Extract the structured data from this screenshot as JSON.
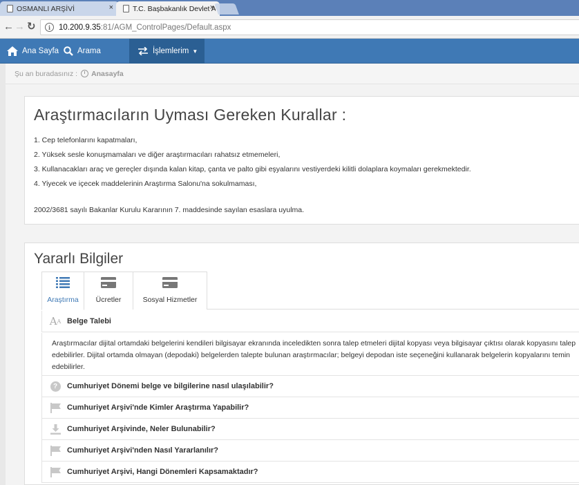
{
  "browser": {
    "tabs": [
      {
        "title": "OSMANLI ARŞİVİ",
        "close": "×"
      },
      {
        "title": "T.C. Başbakanlık Devlet A",
        "close": "×"
      }
    ],
    "url_host": "10.200.9.35",
    "url_path": ":81/AGM_ControlPages/Default.aspx"
  },
  "navbar": {
    "home": "Ana Sayfa",
    "search": "Arama",
    "operations": "İşlemlerim",
    "accent": "#3f79b5"
  },
  "breadcrumb": {
    "prefix": "Şu an buradasınız :",
    "current": "Anasayfa"
  },
  "rules_panel": {
    "title": "Araştırmacıların Uyması Gereken Kurallar :",
    "rules": [
      "1. Cep telefonlarını kapatmaları,",
      "2. Yüksek sesle konuşmamaları ve diğer araştırmacıları rahatsız etmemeleri,",
      "3. Kullanacakları araç ve gereçler dışında kalan kitap, çanta ve palto gibi eşyalarını vestiyerdeki kilitli dolaplara koymaları gerekmektedir.",
      "4. Yiyecek ve içecek maddelerinin Araştırma Salonu'na sokulmaması,"
    ],
    "note": "2002/3681 sayılı Bakanlar Kurulu Kararının 7. maddesinde sayılan esaslara uyulma."
  },
  "info_panel": {
    "title": "Yararlı Bilgiler",
    "tabs": [
      {
        "label": "Araştırma",
        "icon": "list-icon"
      },
      {
        "label": "Ücretler",
        "icon": "card-icon"
      },
      {
        "label": "Sosyal Hizmetler",
        "icon": "card-icon"
      }
    ],
    "items": [
      {
        "label": "Belge Talebi",
        "icon": "font-size-icon"
      },
      {
        "label": "Cumhuriyet Dönemi belge ve bilgilerine nasıl ulaşılabilir?",
        "icon": "question-icon"
      },
      {
        "label": "Cumhuriyet Arşivi'nde Kimler Araştırma Yapabilir?",
        "icon": "flag-icon"
      },
      {
        "label": "Cumhuriyet Arşivinde, Neler Bulunabilir?",
        "icon": "download-icon"
      },
      {
        "label": "Cumhuriyet Arşivi'nden Nasıl Yararlanılır?",
        "icon": "flag-icon"
      },
      {
        "label": "Cumhuriyet Arşivi, Hangi Dönemleri Kapsamaktadır?",
        "icon": "flag-icon"
      }
    ],
    "expanded_body": [
      "Araştırmacılar dijital ortamdaki belgelerini kendileri bilgisayar ekranında inceledikten sonra talep etmeleri dijital kopyası veya bilgisayar çıktısı olarak kopyasını talep",
      "edebilirler. Dijital ortamda olmayan (depodaki) belgelerden talepte bulunan araştırmacılar; belgeyi depodan iste seçeneğini kullanarak belgelerin kopyalarını temin",
      "edebilirler."
    ]
  }
}
